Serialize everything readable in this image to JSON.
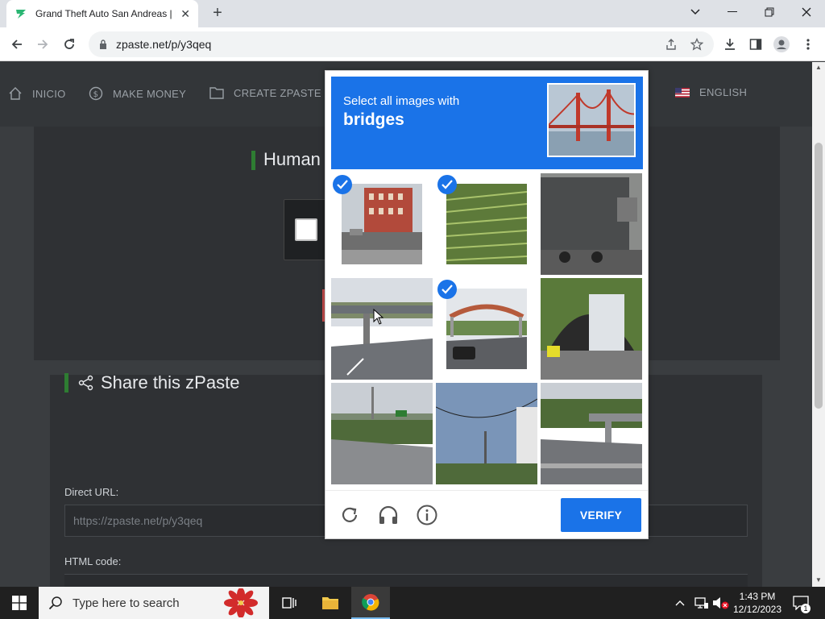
{
  "browser": {
    "tab_title": "Grand Theft Auto San Andreas | M",
    "tab_close": "✕",
    "new_tab": "+",
    "url": "zpaste.net/p/y3qeq"
  },
  "site_nav": {
    "items": [
      "INICIO",
      "MAKE MONEY",
      "CREATE ZPASTE"
    ],
    "language": "ENGLISH"
  },
  "page": {
    "human_title": "Human",
    "share_title": "Share this zPaste",
    "direct_url_label": "Direct URL:",
    "direct_url_value": "https://zpaste.net/p/y3qeq",
    "html_code_label": "HTML code:"
  },
  "captcha": {
    "instruction": "Select all images with",
    "target": "bridges",
    "tiles": [
      {
        "name": "tile-buildings-street",
        "selected": true
      },
      {
        "name": "tile-crop-field",
        "selected": true
      },
      {
        "name": "tile-truck-trailer",
        "selected": false
      },
      {
        "name": "tile-highway-overpass",
        "selected": false
      },
      {
        "name": "tile-pedestrian-bridge",
        "selected": true
      },
      {
        "name": "tile-truck-tunnel",
        "selected": false
      },
      {
        "name": "tile-road-overpass-distant",
        "selected": false
      },
      {
        "name": "tile-sky-powerlines",
        "selected": false
      },
      {
        "name": "tile-overpass-trees",
        "selected": false
      }
    ],
    "verify_label": "VERIFY"
  },
  "taskbar": {
    "search_placeholder": "Type here to search",
    "time": "1:43 PM",
    "date": "12/12/2023",
    "notifications": "1"
  },
  "colors": {
    "accent": "#1a73e8",
    "page_bg": "#3a3d40"
  }
}
